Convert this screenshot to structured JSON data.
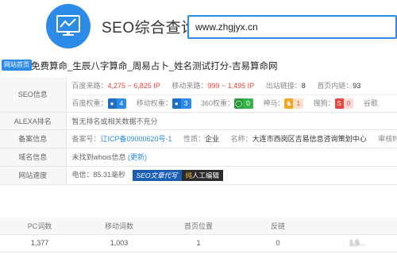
{
  "app": {
    "title": "SEO综合查询"
  },
  "search": {
    "value": "www.zhgjyx.cn"
  },
  "site": {
    "badge": "网站首页",
    "title": "免费算命_生辰八字算命_周易占卜_姓名测试打分-吉易算命网"
  },
  "seo": {
    "label": "SEO信息",
    "line1": [
      {
        "k": "百度来路：",
        "v": "4,275 ~ 6,825 IP"
      },
      {
        "k": "移动来路：",
        "v": "999 ~ 1,495 IP"
      },
      {
        "k": "出站链接：",
        "v": "8"
      },
      {
        "k": "首页内链：",
        "v": "93"
      }
    ],
    "line2": [
      {
        "k": "百度权重：",
        "v": "4"
      },
      {
        "k": "移动权重：",
        "v": "3"
      },
      {
        "k": "360权重：",
        "v": "0"
      },
      {
        "k": "神马：",
        "v": "1"
      },
      {
        "k": "搜狗：",
        "v": "0"
      },
      {
        "k": "谷歌",
        "v": ""
      }
    ]
  },
  "alexa": {
    "label": "ALEXA排名",
    "value": "暂无排名或相关数据不充分"
  },
  "icp": {
    "label": "备案信息",
    "no_label": "备案号：",
    "no_value": "辽ICP备09000620号-1",
    "type_label": "性质：",
    "type_value": "企业",
    "name_label": "名称：",
    "name_value": "大连市西岗区吉易信息咨询策划中心",
    "audit_label": "审核时间："
  },
  "domain": {
    "label": "域名信息",
    "value": "未找到whois信息",
    "refresh": "(更新)"
  },
  "speed": {
    "label": "网站速度",
    "value": "电信：85.31毫秒",
    "tag1": "SEO文章代写",
    "tag2_prefix": "纯",
    "tag2_rest": "人工编辑"
  },
  "stats": {
    "headers": [
      "PC词数",
      "移动词数",
      "首页位置",
      "反链",
      ""
    ],
    "values": [
      "1,377",
      "1,003",
      "1",
      "0",
      "1,5..."
    ]
  },
  "colors": {
    "accent": "#2b8be6",
    "red": "#e8473f"
  }
}
